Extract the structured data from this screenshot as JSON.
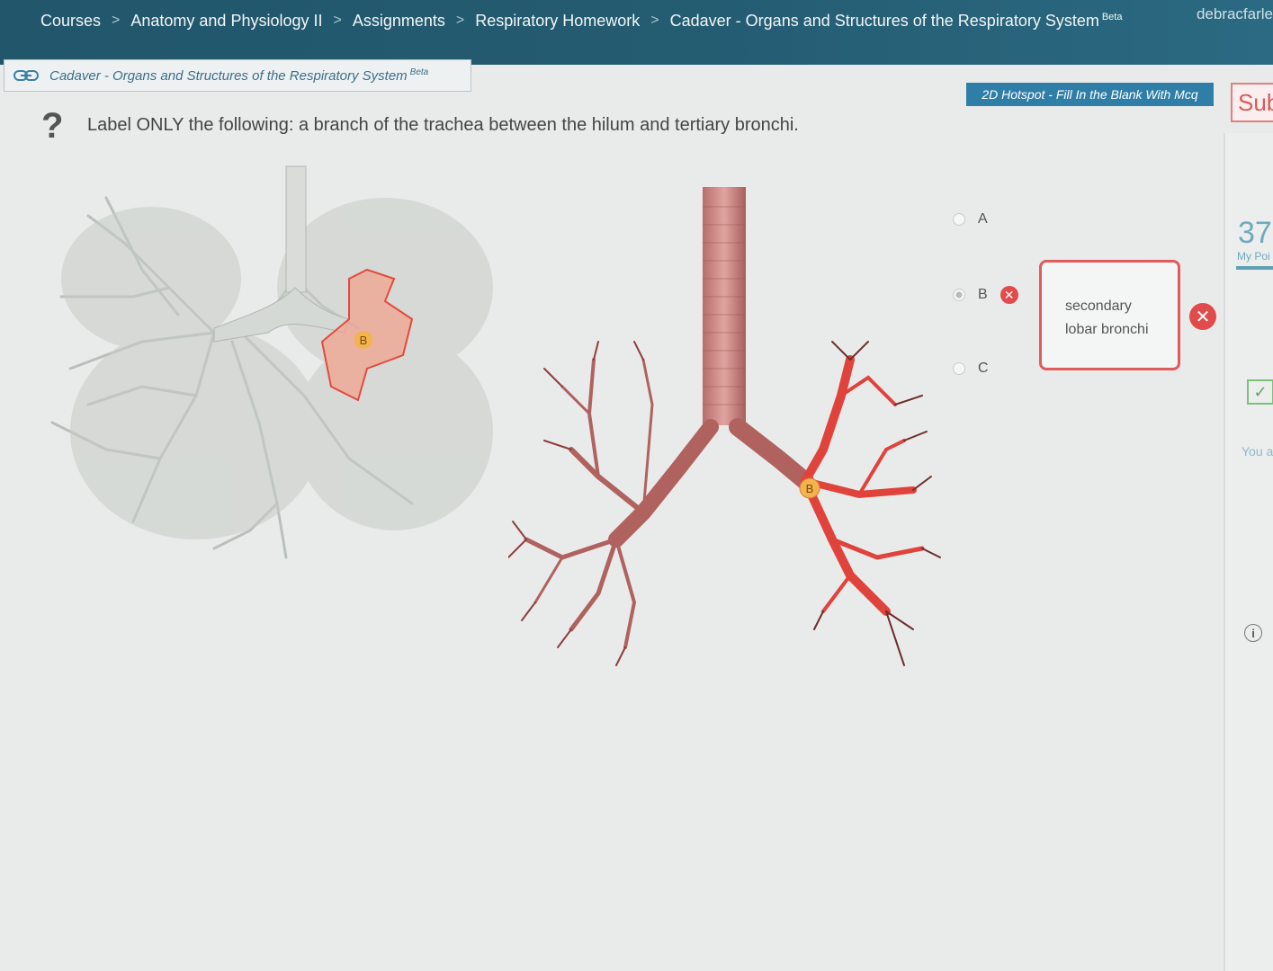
{
  "breadcrumb": {
    "items": [
      "Courses",
      "Anatomy and Physiology II",
      "Assignments",
      "Respiratory Homework",
      "Cadaver - Organs and Structures of the Respiratory System"
    ],
    "last_badge": "Beta",
    "separator": ">"
  },
  "user": {
    "name": "debracfarle"
  },
  "assignment": {
    "title": "Cadaver - Organs and Structures of the Respiratory System",
    "title_badge": "Beta",
    "question_type": "2D Hotspot - Fill In the Blank With Mcq",
    "submit_label": "Sub"
  },
  "question": {
    "icon": "?",
    "text": "Label ONLY the following: a branch of the trachea between the hilum and tertiary bronchi."
  },
  "hotspot_marker": "B",
  "options": [
    {
      "label": "A",
      "selected": false,
      "wrong": false
    },
    {
      "label": "B",
      "selected": true,
      "wrong": true
    },
    {
      "label": "C",
      "selected": false,
      "wrong": false
    }
  ],
  "answer": {
    "line1": "secondary",
    "line2": "lobar bronchi",
    "status_icon": "x-icon"
  },
  "sidebar": {
    "points": "37",
    "points_label": "My Poi",
    "you_text": "You a",
    "info_icon": "i"
  },
  "colors": {
    "nav_bg": "#21566b",
    "accent": "#2f7ea8",
    "error": "#e14b4b",
    "success": "#5aa85a"
  }
}
